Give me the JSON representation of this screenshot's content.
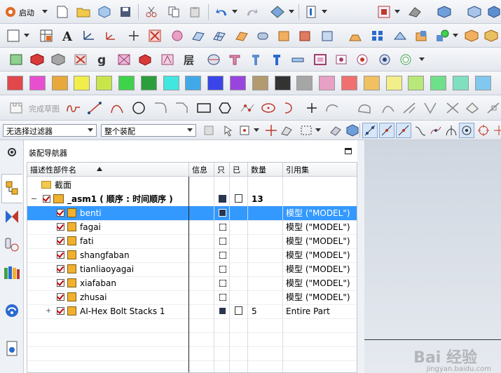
{
  "toolbar": {
    "start_label": "启动",
    "sketch_finish_label": "完成草图"
  },
  "swatches": {
    "row1": [
      "#e0484c",
      "#e84fd0",
      "#e8a83a",
      "#f1ee4a",
      "#c8e64a",
      "#3fd24b",
      "#2c9f3c",
      "#3fe7e0",
      "#42a9e8",
      "#3a45e8",
      "#9a44e0",
      "#b39b70",
      "#333333",
      "#a6a6a6",
      "#e8a0c4",
      "#f07070",
      "#f2c060",
      "#f2ee8a",
      "#b8e87a",
      "#6fe08a",
      "#7fe0c0",
      "#80c8f0"
    ],
    "row2": [
      "#e02a2a",
      "#e8a030",
      "#f0f040"
    ]
  },
  "filters": {
    "selection_filter": "无选择过滤器",
    "scope": "整个装配"
  },
  "navigator": {
    "title": "装配导航器",
    "columns": [
      "描述性部件名",
      "信息",
      "只",
      "已",
      "数量",
      "引用集"
    ]
  },
  "tree": {
    "section_row": "截面",
    "root": {
      "name": "_asm1 ( 顺序 : 时间顺序 )",
      "count": "13"
    },
    "parts": [
      {
        "name": "benti",
        "ref": "模型 (\"MODEL\")",
        "selected": true
      },
      {
        "name": "fagai",
        "ref": "模型 (\"MODEL\")"
      },
      {
        "name": "fati",
        "ref": "模型 (\"MODEL\")"
      },
      {
        "name": "shangfaban",
        "ref": "模型 (\"MODEL\")"
      },
      {
        "name": "tianliaoyagai",
        "ref": "模型 (\"MODEL\")"
      },
      {
        "name": "xiafaban",
        "ref": "模型 (\"MODEL\")"
      },
      {
        "name": "zhusai",
        "ref": "模型 (\"MODEL\")"
      },
      {
        "name": "AI-Hex Bolt Stacks 1",
        "ref": "Entire Part",
        "count": "5"
      }
    ]
  },
  "watermark": {
    "brand": "Bai 经验",
    "url": "jingyan.baidu.com"
  },
  "colors": {
    "selection": "#3399ff",
    "check": "#c00000",
    "part_cube": "#f0b030"
  }
}
